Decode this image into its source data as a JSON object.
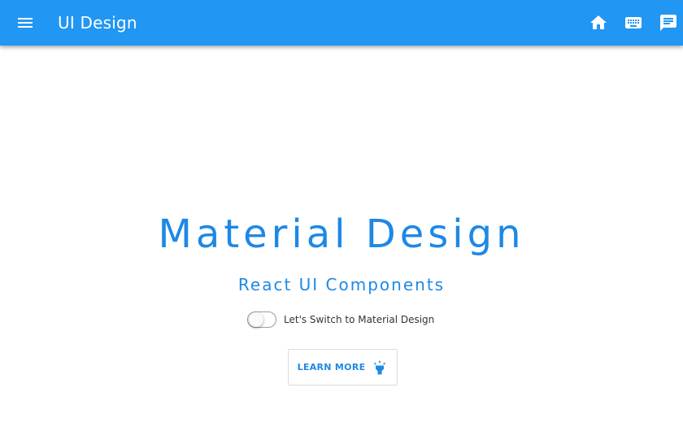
{
  "appbar": {
    "title": "UI Design",
    "background_color": "#2196f3",
    "menu_icon": "menu-icon",
    "actions": [
      {
        "icon": "home-icon"
      },
      {
        "icon": "keyboard-icon"
      },
      {
        "icon": "chat-icon"
      }
    ]
  },
  "hero": {
    "title": "Material Design",
    "subtitle": "React UI Components",
    "accent_color": "#1e88e5"
  },
  "toggle": {
    "label": "Let's Switch to Material Design",
    "checked": false
  },
  "learn_more": {
    "label": "LEARN MORE",
    "icon": "lightbulb-icon"
  }
}
